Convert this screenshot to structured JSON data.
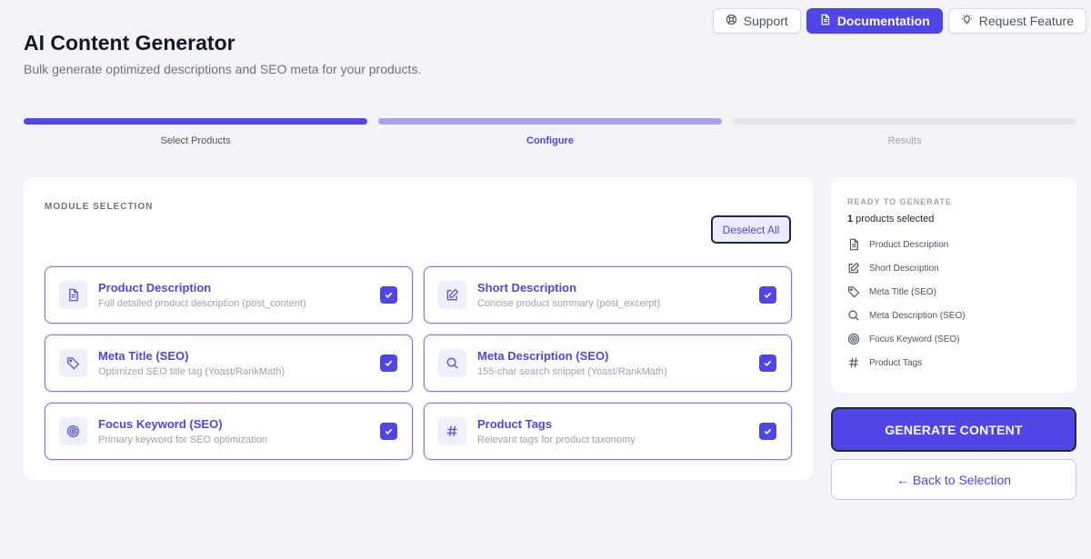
{
  "header": {
    "title": "AI Content Generator",
    "subtitle": "Bulk generate optimized descriptions and SEO meta for your products."
  },
  "top_actions": [
    {
      "label": "Support",
      "icon": "lifebuoy-icon"
    },
    {
      "label": "Documentation",
      "icon": "document-icon"
    },
    {
      "label": "Request Feature",
      "icon": "lightbulb-icon"
    }
  ],
  "steps": [
    {
      "label": "Select Products",
      "state": "done"
    },
    {
      "label": "Configure",
      "state": "active"
    },
    {
      "label": "Results",
      "state": "todo"
    }
  ],
  "modules": {
    "section_label": "MODULE SELECTION",
    "deselect_label": "Deselect All",
    "items": [
      {
        "title": "Product Description",
        "desc": "Full detailed product description (post_content)",
        "icon": "document-icon",
        "checked": true
      },
      {
        "title": "Short Description",
        "desc": "Concise product summary (post_excerpt)",
        "icon": "edit-icon",
        "checked": true
      },
      {
        "title": "Meta Title (SEO)",
        "desc": "Optimized SEO title tag (Yoast/RankMath)",
        "icon": "tag-icon",
        "checked": true
      },
      {
        "title": "Meta Description (SEO)",
        "desc": "155-char search snippet (Yoast/RankMath)",
        "icon": "search-icon",
        "checked": true
      },
      {
        "title": "Focus Keyword (SEO)",
        "desc": "Primary keyword for SEO optimization",
        "icon": "target-icon",
        "checked": true
      },
      {
        "title": "Product Tags",
        "desc": "Relevant tags for product taxonomy",
        "icon": "hash-icon",
        "checked": true
      }
    ]
  },
  "summary": {
    "label": "READY TO GENERATE",
    "count": "1",
    "count_suffix": " products selected",
    "items": [
      {
        "label": "Product Description",
        "icon": "document-icon"
      },
      {
        "label": "Short Description",
        "icon": "edit-icon"
      },
      {
        "label": "Meta Title (SEO)",
        "icon": "tag-icon"
      },
      {
        "label": "Meta Description (SEO)",
        "icon": "search-icon"
      },
      {
        "label": "Focus Keyword (SEO)",
        "icon": "target-icon"
      },
      {
        "label": "Product Tags",
        "icon": "hash-icon"
      }
    ]
  },
  "actions": {
    "generate_label": "GENERATE CONTENT",
    "back_label": "← Back to Selection"
  },
  "colors": {
    "accent": "#4f46e5",
    "accent_light": "#a5a1ef",
    "background": "#f4f4f8"
  }
}
